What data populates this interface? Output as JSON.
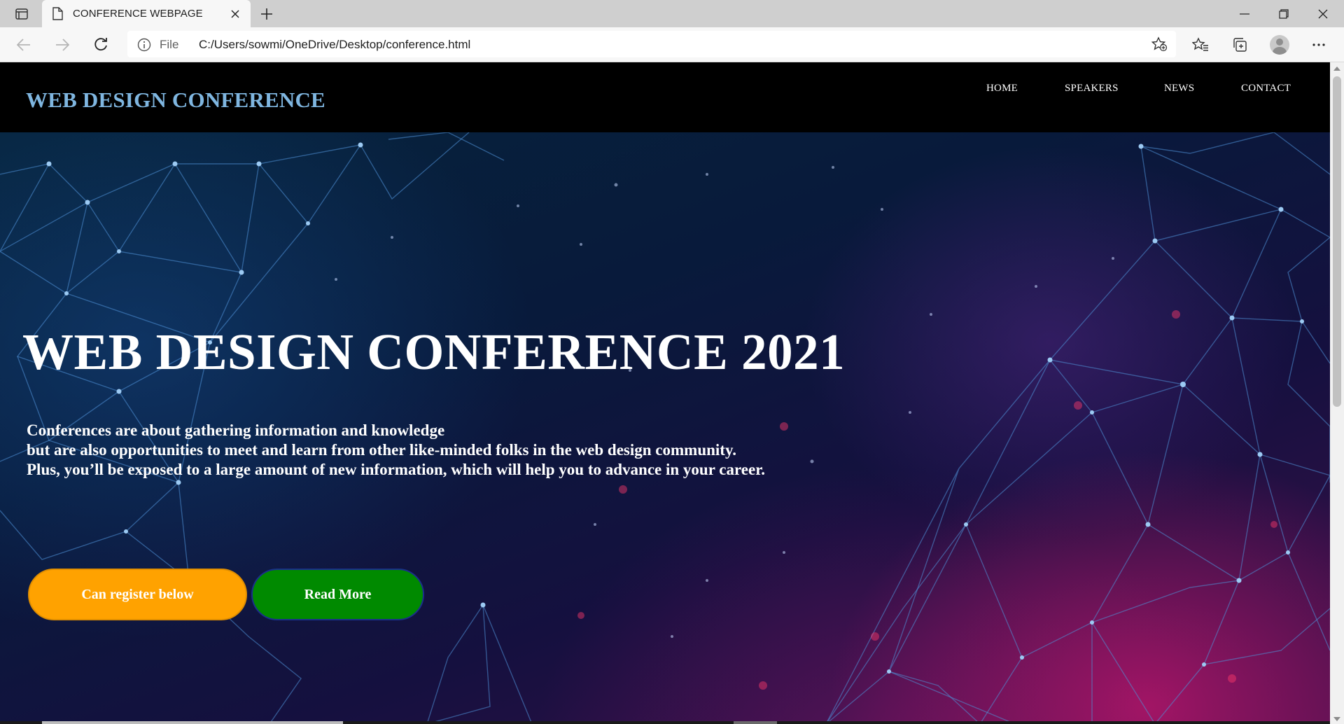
{
  "browser": {
    "tab_title": "CONFERENCE WEBPAGE",
    "address_scheme": "File",
    "address_url": "C:/Users/sowmi/OneDrive/Desktop/conference.html",
    "icons": {
      "tab_actions": "tab-actions-icon",
      "document": "document-icon",
      "close": "close-icon",
      "new_tab": "plus-icon",
      "back": "back-arrow-icon",
      "forward": "forward-arrow-icon",
      "refresh": "refresh-icon",
      "info": "info-icon",
      "add_favorite": "add-favorite-icon",
      "favorites": "favorites-icon",
      "collections": "collections-icon",
      "profile": "profile-avatar-icon",
      "more": "more-icon",
      "minimize": "minimize-icon",
      "restore": "restore-icon",
      "window_close": "window-close-icon"
    }
  },
  "site": {
    "logo": "WEB DESIGN CONFERENCE",
    "nav": [
      "HOME",
      "SPEAKERS",
      "NEWS",
      "CONTACT"
    ],
    "hero": {
      "title": "WEB DESIGN CONFERENCE 2021",
      "lines": [
        "Conferences are about gathering information and knowledge",
        "but are also opportunities to meet and learn from other like-minded folks in the web design community.",
        "Plus, you’ll be exposed to a large amount of new information, which will help you to advance in your career."
      ],
      "primary_button": "Can register below",
      "secondary_button": "Read More"
    },
    "colors": {
      "header_bg": "#000000",
      "logo": "#7fb6e0",
      "primary_button": "#ffa200",
      "secondary_button": "#008a00"
    }
  }
}
